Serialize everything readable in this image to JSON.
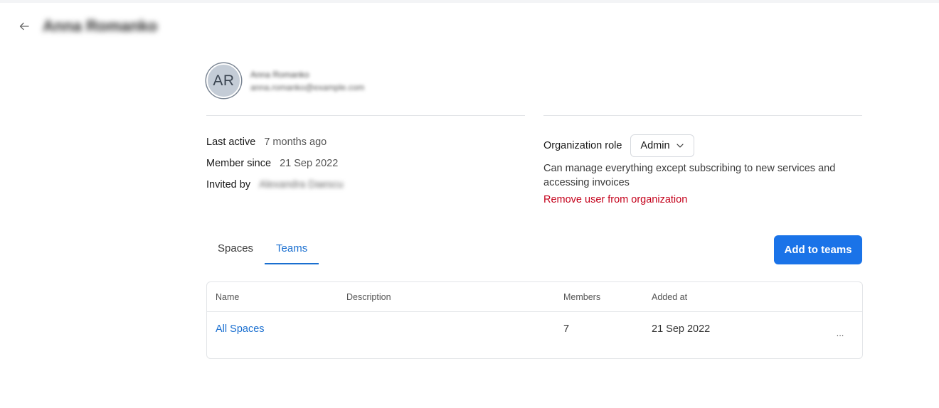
{
  "header": {
    "title": "Anna Romanko"
  },
  "profile": {
    "initials": "AR",
    "name": "Anna Romanko",
    "email": "anna.romanko@example.com"
  },
  "meta": {
    "last_active_label": "Last active",
    "last_active_value": "7 months ago",
    "member_since_label": "Member since",
    "member_since_value": "21 Sep 2022",
    "invited_by_label": "Invited by",
    "invited_by_value": "Alexandra Daescu"
  },
  "organization": {
    "role_label": "Organization role",
    "role_value": "Admin",
    "role_description": "Can manage everything except subscribing to new services and accessing invoices",
    "remove_label": "Remove user from organization"
  },
  "tabs": [
    {
      "label": "Spaces",
      "active": false
    },
    {
      "label": "Teams",
      "active": true
    }
  ],
  "actions": {
    "add_to_teams": "Add to teams"
  },
  "table": {
    "columns": [
      "Name",
      "Description",
      "Members",
      "Added at"
    ],
    "rows": [
      {
        "name": "All Spaces",
        "description": "",
        "members": "7",
        "added_at": "21 Sep 2022",
        "menu": "..."
      }
    ]
  },
  "colors": {
    "accent": "#1a73e8",
    "link": "#1a6fd0",
    "danger": "#c4001a"
  }
}
